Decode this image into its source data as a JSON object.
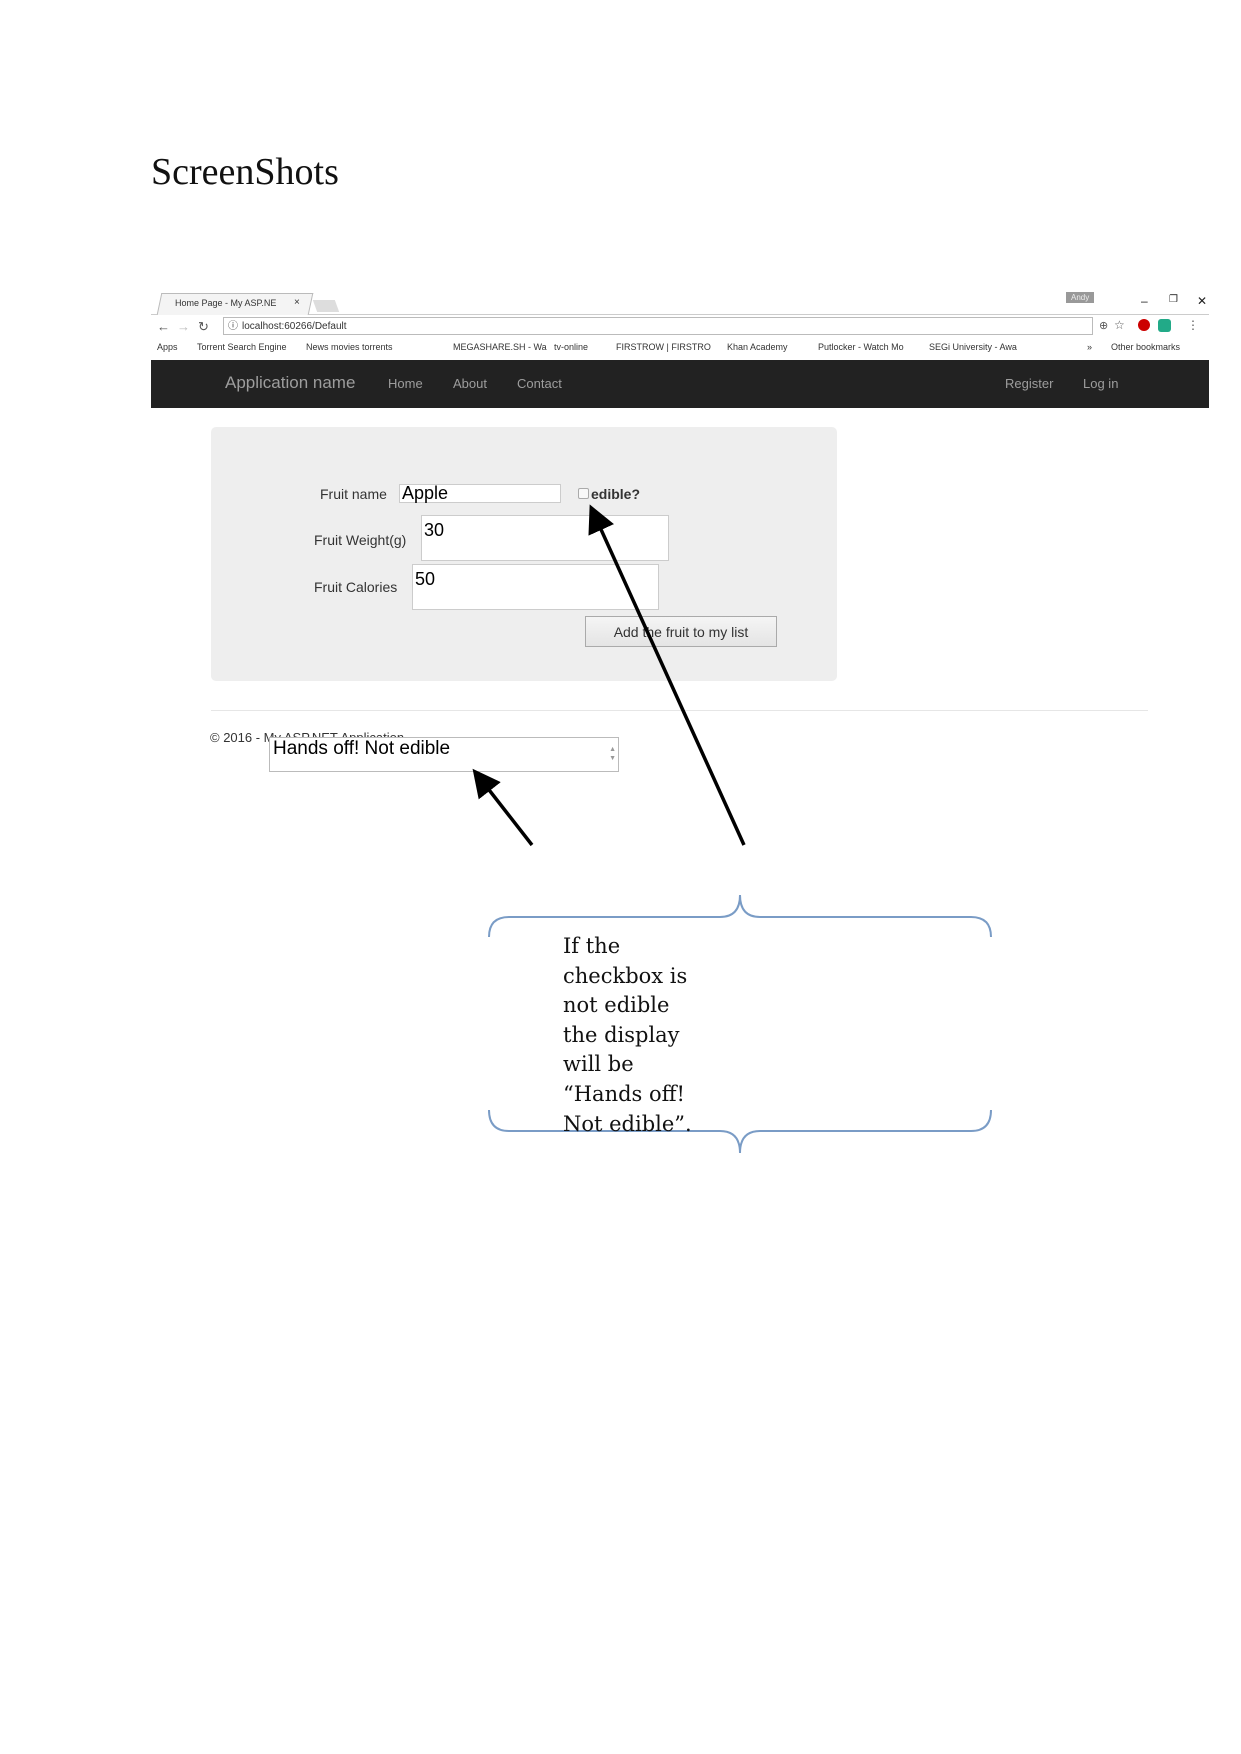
{
  "document": {
    "title": "ScreenShots"
  },
  "browser": {
    "tab_title": "Home Page - My ASP.NE",
    "tab_close": "×",
    "user_badge": "Andy",
    "window_controls": {
      "minimize": "–",
      "restore": "❐",
      "close": "✕"
    },
    "url": "localhost:60266/Default",
    "bookmarks": [
      "Apps",
      "Torrent Search Engine",
      "News movies torrents",
      "MEGASHARE.SH - Wa",
      "tv-online",
      "FIRSTROW | FIRSTRO",
      "Khan Academy",
      "Putlocker - Watch Mo",
      "SEGi University - Awa"
    ],
    "bookmarks_more": "»",
    "other_bookmarks": "Other bookmarks"
  },
  "navbar": {
    "brand": "Application name",
    "links": [
      "Home",
      "About",
      "Contact"
    ],
    "right_links": [
      "Register",
      "Log in"
    ]
  },
  "form": {
    "fruit_name_label": "Fruit name",
    "fruit_name_value": "Apple",
    "edible_label": "edible?",
    "edible_checked": false,
    "weight_label": "Fruit Weight(g)",
    "weight_value": "30",
    "calories_label": "Fruit Calories",
    "calories_value": "50",
    "submit_label": "Add the fruit to my list"
  },
  "footer": {
    "text": "© 2016 - My ASP.NET Application"
  },
  "output": {
    "value": "Hands off! Not edible"
  },
  "annotation": {
    "note": "If the checkbox is not edible the display will be “Hands off! Not edible”.",
    "brace_color": "#7a9cc6"
  }
}
